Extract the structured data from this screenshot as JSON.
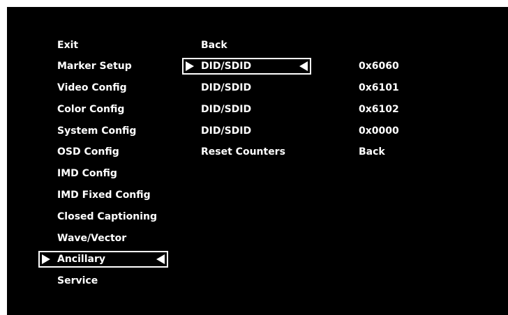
{
  "menu": {
    "items": [
      {
        "label": "Exit"
      },
      {
        "label": "Marker Setup"
      },
      {
        "label": "Video Config"
      },
      {
        "label": "Color Config"
      },
      {
        "label": "System Config"
      },
      {
        "label": "OSD Config"
      },
      {
        "label": "IMD Config"
      },
      {
        "label": "IMD Fixed Config"
      },
      {
        "label": "Closed Captioning"
      },
      {
        "label": "Wave/Vector"
      },
      {
        "label": "Ancillary",
        "selected": true
      },
      {
        "label": "Service"
      }
    ]
  },
  "submenu": {
    "items": [
      {
        "label": "Back",
        "value": ""
      },
      {
        "label": "DID/SDID",
        "value": "0x6060",
        "selected": true
      },
      {
        "label": "DID/SDID",
        "value": "0x6101"
      },
      {
        "label": "DID/SDID",
        "value": "0x6102"
      },
      {
        "label": "DID/SDID",
        "value": "0x0000"
      },
      {
        "label": "Reset Counters",
        "value": "Back"
      }
    ]
  },
  "colors": {
    "background": "#000000",
    "text": "#ffffff",
    "highlight_border": "#ffffff"
  }
}
